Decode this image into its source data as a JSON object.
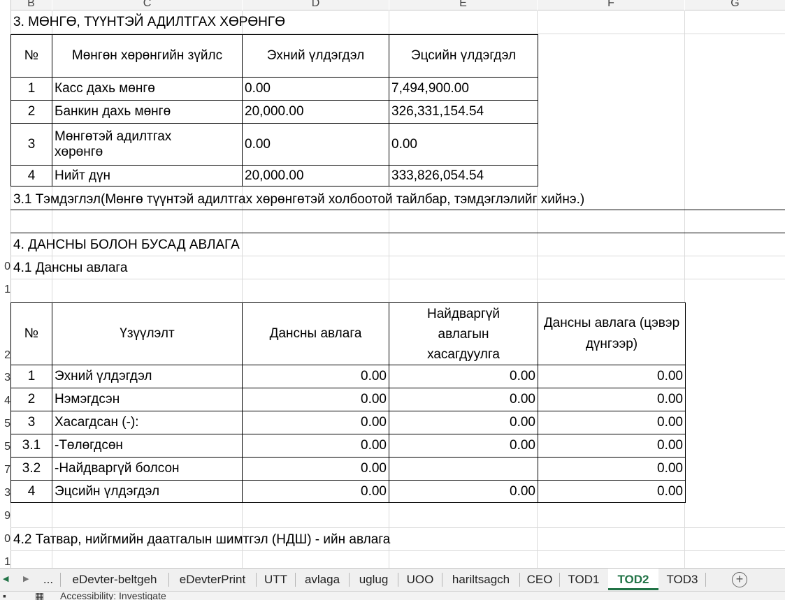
{
  "columns": [
    "B",
    "C",
    "D",
    "E",
    "F",
    "G"
  ],
  "row_labels": {
    "r10": "0",
    "r11": "1",
    "r12": "2",
    "r13": "3",
    "r14": "4",
    "r15": "5",
    "r16": "5",
    "r17": "7",
    "r18": "3",
    "r19": "9",
    "r20": "0",
    "r21": "1"
  },
  "section3": {
    "title": "3. МӨНГӨ, ТҮҮНТЭЙ АДИЛТГАХ ХӨРӨНГӨ",
    "headers": [
      "№",
      "Мөнгөн хөрөнгийн зүйлс",
      "Эхний үлдэгдэл",
      "Эцсийн үлдэгдэл"
    ],
    "rows": [
      [
        "1",
        "Касс дахь мөнгө",
        "0.00",
        "7,494,900.00"
      ],
      [
        "2",
        "Банкин дахь мөнгө",
        "20,000.00",
        "326,331,154.54"
      ],
      [
        "3",
        "Мөнгөтэй адилтгах хөрөнгө",
        "0.00",
        "0.00"
      ],
      [
        "4",
        "Нийт дүн",
        "20,000.00",
        "333,826,054.54"
      ]
    ],
    "note": "3.1 Тэмдэглэл(Мөнгө түүнтэй адилтгах хөрөнгөтэй холбоотой тайлбар, тэмдэглэлийг хийнэ.)"
  },
  "section4": {
    "title": "4. ДАНСНЫ БОЛОН БУСАД АВЛАГА",
    "subtitle": "4.1 Дансны авлага",
    "headers": [
      "№",
      "Үзүүлэлт",
      "Дансны авлага",
      "Найдваргүй авлагын хасагдуулга",
      "Дансны авлага (цэвэр дүнгээр)"
    ],
    "rows": [
      [
        "1",
        "Эхний үлдэгдэл",
        "0.00",
        "0.00",
        "0.00"
      ],
      [
        "2",
        "Нэмэгдсэн",
        "0.00",
        "0.00",
        "0.00"
      ],
      [
        "3",
        "Хасагдсан (-):",
        "0.00",
        "0.00",
        "0.00"
      ],
      [
        "3.1",
        "-Төлөгдсөн",
        "0.00",
        "0.00",
        "0.00"
      ],
      [
        "3.2",
        "-Найдваргүй болсон",
        "0.00",
        "",
        "0.00"
      ],
      [
        "4",
        "Эцсийн үлдэгдэл",
        "0.00",
        "0.00",
        "0.00"
      ]
    ],
    "subtitle2": "4.2 Татвар, нийгмийн даатгалын шимтгэл (НДШ) - ийн авлага"
  },
  "tabs": {
    "more": "...",
    "items": [
      "eDevter-beltgeh",
      "eDevterPrint",
      "UTT",
      "avlaga",
      "uglug",
      "UOO",
      "hariltsagch",
      "CEO",
      "TOD1",
      "TOD2",
      "TOD3"
    ],
    "active": "TOD2",
    "add_label": "+"
  },
  "statusbar": {
    "text": "Accessibility: Investigate"
  }
}
